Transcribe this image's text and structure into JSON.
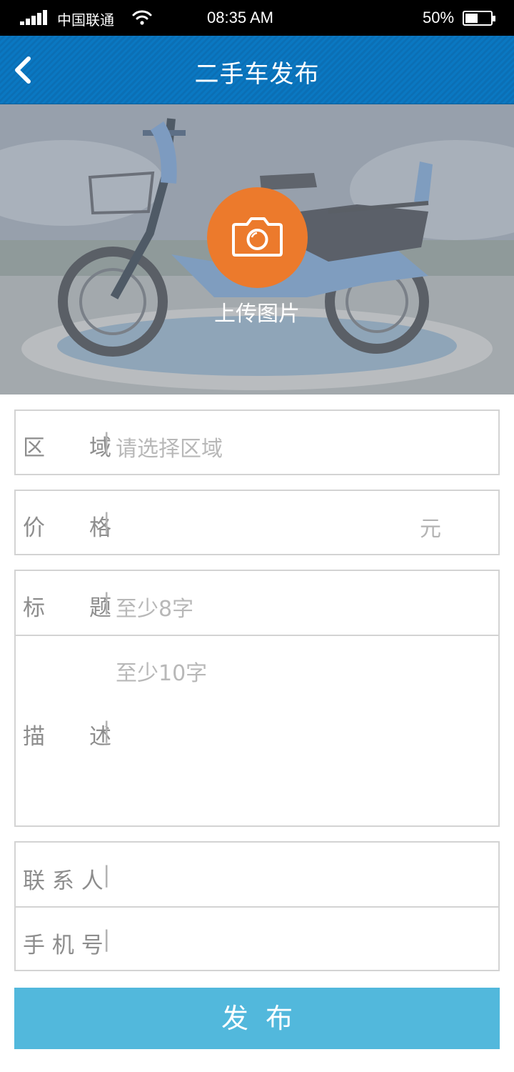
{
  "status_bar": {
    "carrier": "中国联通",
    "time": "08:35 AM",
    "battery_percent": "50%",
    "battery_level": 0.5,
    "icons": [
      "signal-icon",
      "wifi-icon",
      "battery-icon"
    ]
  },
  "nav": {
    "title": "二手车发布",
    "back_icon": "chevron-left-icon"
  },
  "photo": {
    "upload_label": "上传图片",
    "upload_icon": "camera-icon",
    "accent": "#ec7a2c"
  },
  "form": {
    "region": {
      "label": "区　　域",
      "separator": "|",
      "placeholder": "请选择区域"
    },
    "price": {
      "label": "价　　格",
      "separator": "|",
      "value": "",
      "unit": "元"
    },
    "title": {
      "label": "标　　题",
      "separator": "|",
      "placeholder": "至少8字"
    },
    "description": {
      "label": "描　　述",
      "separator": "|",
      "placeholder": "至少10字"
    },
    "contact": {
      "label": "联 系 人",
      "separator": "|",
      "value": ""
    },
    "phone": {
      "label": "手 机 号",
      "separator": "|",
      "value": ""
    }
  },
  "submit": {
    "label": "发布",
    "color": "#52b8dc"
  },
  "colors": {
    "nav": "#0a78c2",
    "border": "#d3d3d3",
    "label": "#8d8d8d",
    "placeholder": "#b8b8b8"
  }
}
